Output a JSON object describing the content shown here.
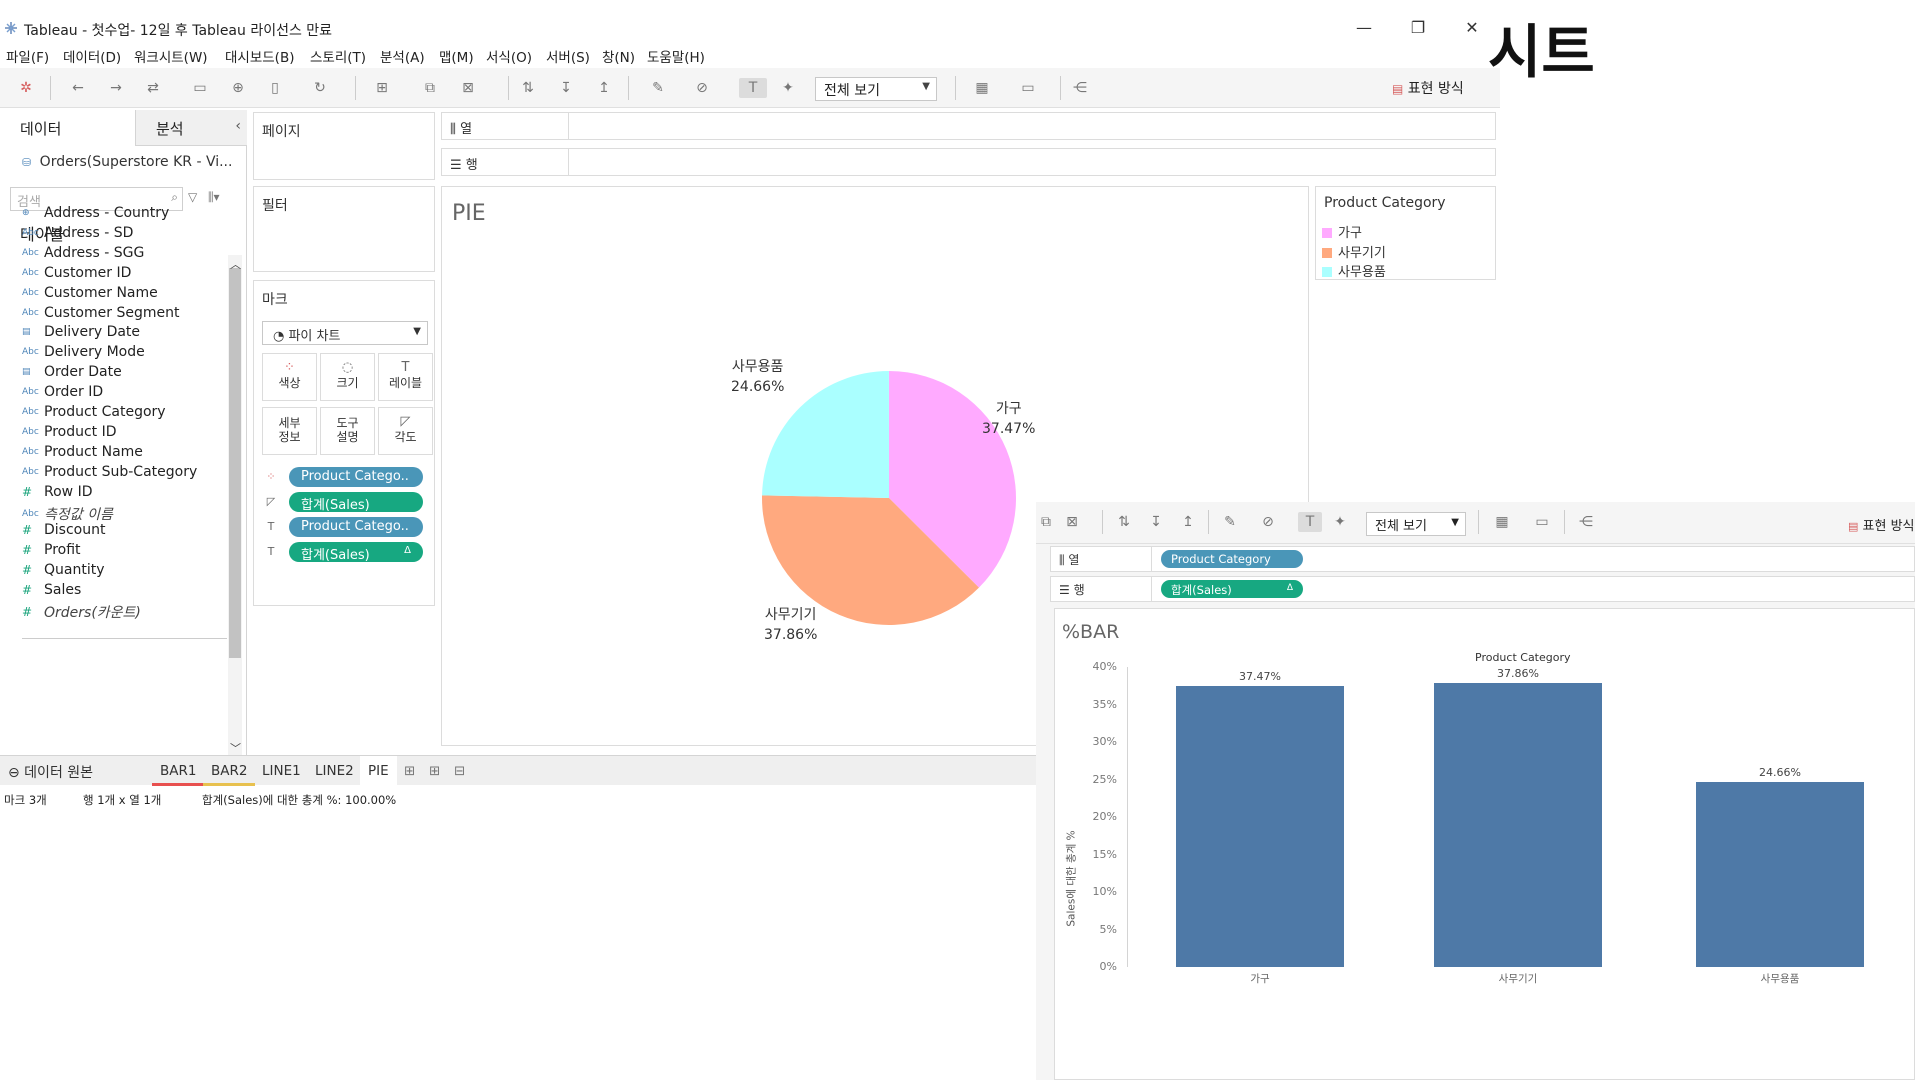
{
  "window": {
    "title": "Tableau - 첫수업- 12일 후 Tableau 라이선스 만료",
    "minimize_glyph": "—",
    "restore_glyph": "❐",
    "close_glyph": "✕"
  },
  "menu": [
    "파일(F)",
    "데이터(D)",
    "워크시트(W)",
    "대시보드(B)",
    "스토리(T)",
    "분석(A)",
    "맵(M)",
    "서식(O)",
    "서버(S)",
    "창(N)",
    "도움말(H)"
  ],
  "toolbar": {
    "view_select": "전체 보기",
    "show_me": "표현 방식"
  },
  "data_pane": {
    "tab_data": "데이터",
    "tab_analysis": "분석",
    "collapse_glyph": "‹",
    "datasource": "Orders(Superstore KR - Vi...",
    "search_placeholder": "검색",
    "tables_heading": "테이블",
    "fields": [
      {
        "name": "Address - Country",
        "type": "geo"
      },
      {
        "name": "Address - SD",
        "type": "abc"
      },
      {
        "name": "Address - SGG",
        "type": "abc"
      },
      {
        "name": "Customer ID",
        "type": "abc"
      },
      {
        "name": "Customer Name",
        "type": "abc"
      },
      {
        "name": "Customer Segment",
        "type": "abc"
      },
      {
        "name": "Delivery Date",
        "type": "date"
      },
      {
        "name": "Delivery Mode",
        "type": "abc"
      },
      {
        "name": "Order Date",
        "type": "date"
      },
      {
        "name": "Order ID",
        "type": "abc"
      },
      {
        "name": "Product Category",
        "type": "abc"
      },
      {
        "name": "Product ID",
        "type": "abc"
      },
      {
        "name": "Product Name",
        "type": "abc"
      },
      {
        "name": "Product Sub-Category",
        "type": "abc"
      },
      {
        "name": "Row ID",
        "type": "num"
      },
      {
        "name": "측정값 이름",
        "type": "abc"
      }
    ],
    "measures": [
      {
        "name": "Discount",
        "type": "num"
      },
      {
        "name": "Profit",
        "type": "num"
      },
      {
        "name": "Quantity",
        "type": "num"
      },
      {
        "name": "Sales",
        "type": "num"
      },
      {
        "name": "Orders(카운트)",
        "type": "num"
      }
    ],
    "type_glyphs": {
      "abc": "Abc",
      "geo": "⊕",
      "date": "▤",
      "num": "#"
    }
  },
  "cards": {
    "pages": "페이지",
    "filters": "필터",
    "marks": "마크",
    "mark_type": "◔ 파이 차트",
    "mark_buttons": [
      {
        "label": "색상",
        "icon": "⁘"
      },
      {
        "label": "크기",
        "icon": "◌"
      },
      {
        "label": "레이블",
        "icon": "T"
      },
      {
        "label": "세부\n정보",
        "icon": ""
      },
      {
        "label": "도구\n설명",
        "icon": ""
      },
      {
        "label": "각도",
        "icon": "◸"
      }
    ],
    "mark_pills": [
      {
        "label": "Product Catego..",
        "kind": "blue",
        "icon": "⁘"
      },
      {
        "label": "합계(Sales)",
        "kind": "green",
        "icon": "◸"
      },
      {
        "label": "Product Catego..",
        "kind": "blue",
        "icon": "T"
      },
      {
        "label": "합계(Sales)",
        "kind": "green",
        "icon": "T",
        "delta": "Δ"
      }
    ]
  },
  "shelves": {
    "columns": "⫼ 열",
    "rows": "☰ 행"
  },
  "pie_view": {
    "title": "PIE",
    "slices": [
      {
        "label": "가구",
        "value": "37.47%",
        "color": "#ffaaff"
      },
      {
        "label": "사무기기",
        "value": "37.86%",
        "color": "#ffa97f"
      },
      {
        "label": "사무용품",
        "value": "24.66%",
        "color": "#aaffff"
      }
    ]
  },
  "legend": {
    "title": "Product Category",
    "items": [
      {
        "label": "가구",
        "color": "#ffaaff"
      },
      {
        "label": "사무기기",
        "color": "#ffa97f"
      },
      {
        "label": "사무용품",
        "color": "#aaffff"
      }
    ]
  },
  "sheet_tabs": {
    "datasource": "⊖ 데이터 원본",
    "tabs": [
      {
        "label": "BAR1",
        "underline": "#e8504f"
      },
      {
        "label": "BAR2",
        "underline": "#e8c14f"
      },
      {
        "label": "LINE1",
        "underline": ""
      },
      {
        "label": "LINE2",
        "underline": ""
      },
      {
        "label": "PIE",
        "underline": ""
      }
    ],
    "new_sheet_glyph": "⊞",
    "new_dashboard_glyph": "⊞",
    "new_story_glyph": "⊟"
  },
  "status": {
    "marks": "마크 3개",
    "rows_cols": "행 1개 x 열 1개",
    "summary": "합계(Sales)에 대한 총계 %: 100.00%"
  },
  "overlay_word": "시트",
  "bar_window": {
    "view_select": "전체 보기",
    "show_me": "표현 방식",
    "columns_label": "⫼ 열",
    "rows_label": "☰ 행",
    "columns_pill": "Product Category",
    "rows_pill": "합계(Sales)",
    "rows_pill_delta": "Δ",
    "view_title": "%BAR"
  },
  "chart_data": {
    "type": "bar",
    "title": "Product Category",
    "categories": [
      "가구",
      "사무기기",
      "사무용품"
    ],
    "values": [
      37.47,
      37.86,
      24.66
    ],
    "value_labels": [
      "37.47%",
      "37.86%",
      "24.66%"
    ],
    "ylabel": "Sales에 대한 총계 %",
    "ylim": [
      0,
      40
    ],
    "yticks": [
      "0%",
      "5%",
      "10%",
      "15%",
      "20%",
      "25%",
      "30%",
      "35%",
      "40%"
    ],
    "bar_color": "#4e79a7",
    "grid": false
  }
}
